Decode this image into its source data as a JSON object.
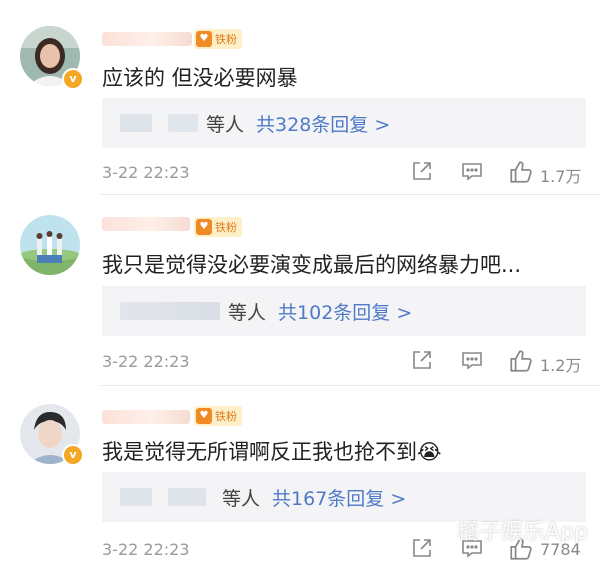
{
  "comments": [
    {
      "fan_label": "铁粉",
      "text": "应该的 但没必要网暴",
      "reply_people": "等人",
      "reply_count": "共328条回复 >",
      "time": "3-22 22:23",
      "likes": "1.7万"
    },
    {
      "fan_label": "铁粉",
      "text": "我只是觉得没必要演变成最后的网络暴力吧...",
      "reply_people": "等人",
      "reply_count": "共102条回复 >",
      "time": "3-22 22:23",
      "likes": "1.2万"
    },
    {
      "fan_label": "铁粉",
      "text": "我是觉得无所谓啊反正我也抢不到",
      "emoji": "😭",
      "reply_people": "等人",
      "reply_count": "共167条回复 >",
      "time": "3-22 22:23",
      "likes": "7784"
    }
  ],
  "watermark": "橘子娱乐App",
  "colors": {
    "link": "#4f7ac8",
    "badge": "#f5a623",
    "fan": "#f08a24"
  }
}
